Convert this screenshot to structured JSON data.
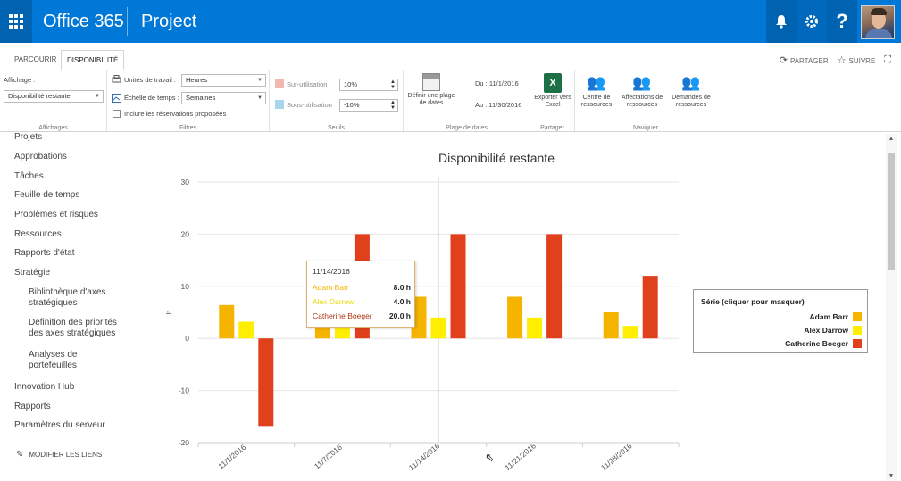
{
  "suite": {
    "brand": "Office 365",
    "app": "Project",
    "bell_icon": "bell-icon",
    "gear_icon": "gear-icon",
    "help_label": "?"
  },
  "tabs": {
    "items": [
      "PARCOURIR",
      "DISPONIBILITÉ"
    ],
    "share_label": "PARTAGER",
    "follow_label": "SUIVRE"
  },
  "ribbon": {
    "affichages": {
      "label": "Affichage :",
      "value": "Disponibilité restante",
      "group": "Affichages"
    },
    "filtres": {
      "units_label": "Unités de travail :",
      "units_value": "Heures",
      "scale_label": "Échelle de temps :",
      "scale_value": "Semaines",
      "include_label": "Inclure les réservations proposées",
      "group": "Filtres"
    },
    "seuils": {
      "over_label": "Sur-utilisation",
      "over_value": "10%",
      "under_label": "Sous-utilisation",
      "under_value": "-10%",
      "over_color": "#f2b8b0",
      "under_color": "#a8d4ec",
      "group": "Seuils"
    },
    "plage": {
      "define_label": "Définir une plage de dates",
      "from": "Du : 11/1/2016",
      "to": "Au : 11/30/2016",
      "group": "Plage de dates"
    },
    "partager": {
      "export_label": "Exporter vers Excel",
      "group": "Partager"
    },
    "naviguer": {
      "center_label": "Centre de ressources",
      "assign_label": "Affectations de ressources",
      "requests_label": "Demandes de ressources",
      "group": "Naviguer"
    }
  },
  "nav": {
    "items": [
      "Projets",
      "Approbations",
      "Tâches",
      "Feuille de temps",
      "Problèmes et risques",
      "Ressources",
      "Rapports d'état",
      "Stratégie"
    ],
    "sub": [
      "Bibliothèque d'axes",
      "stratégiques",
      "Définition des priorités",
      "des axes stratégiques",
      "Analyses de",
      "portefeuilles"
    ],
    "bottom": [
      "Innovation Hub",
      "Rapports",
      "Paramètres du serveur"
    ],
    "modify": "MODIFIER LES LIENS"
  },
  "chart_data": {
    "type": "bar",
    "title": "Disponibilité restante",
    "ylabel": "h",
    "ylim": [
      -20,
      30
    ],
    "yticks": [
      30,
      20,
      10,
      0,
      -10,
      -20
    ],
    "categories": [
      "11/1/2016",
      "11/7/2016",
      "11/14/2016",
      "11/21/2016",
      "11/28/2016"
    ],
    "series": [
      {
        "name": "Adam Barr",
        "color": "#f5b400",
        "values": [
          6.4,
          6.0,
          8.0,
          8.0,
          5.0
        ]
      },
      {
        "name": "Alex Darrow",
        "color": "#ffee00",
        "values": [
          3.2,
          4.0,
          4.0,
          4.0,
          2.4
        ]
      },
      {
        "name": "Catherine Boeger",
        "color": "#e0401c",
        "values": [
          -16.8,
          20.0,
          20.0,
          20.0,
          12.0
        ]
      }
    ],
    "legend": {
      "title": "Série (cliquer pour masquer)",
      "placement": "right"
    },
    "grid": true
  },
  "tooltip": {
    "date": "11/14/2016",
    "rows": [
      {
        "name": "Adam Barr",
        "value": "8.0 h",
        "color": "#f5b400"
      },
      {
        "name": "Alex Darrow",
        "value": "4.0 h",
        "color": "#ffee00"
      },
      {
        "name": "Catherine Boeger",
        "value": "20.0 h",
        "color": "#b03818"
      }
    ]
  }
}
